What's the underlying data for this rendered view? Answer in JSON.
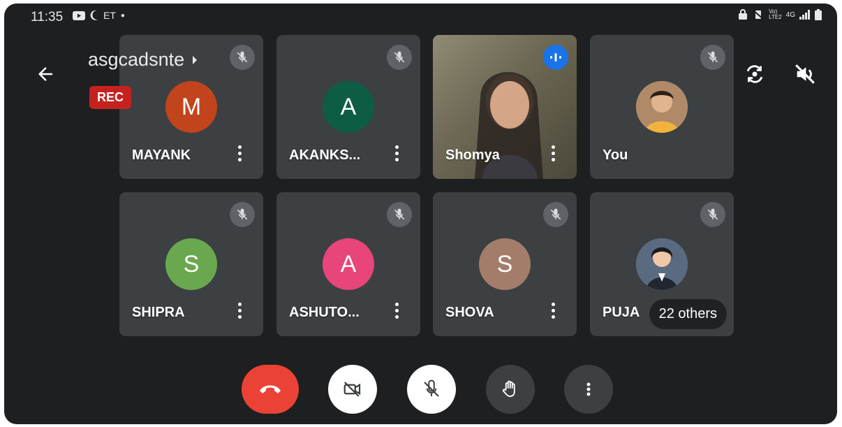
{
  "status_bar": {
    "time": "11:35",
    "carrier_text": "ET",
    "network_text": "4G"
  },
  "meeting": {
    "name": "asgcadsnte",
    "rec_label": "REC"
  },
  "participants": [
    {
      "name": "MAYANK",
      "initial": "M",
      "color": "#c1441c",
      "muted": true
    },
    {
      "name": "AKANKS...",
      "initial": "A",
      "color": "#0d5c46",
      "muted": true
    },
    {
      "name": "Shomya",
      "initial": "",
      "color": "#1a73e8",
      "muted": false,
      "speaking": true
    },
    {
      "name": "You",
      "initial": "",
      "color": "#c9a27a",
      "muted": true
    },
    {
      "name": "SHIPRA",
      "initial": "S",
      "color": "#6aa84f",
      "muted": true
    },
    {
      "name": "ASHUTO...",
      "initial": "A",
      "color": "#e8457a",
      "muted": true
    },
    {
      "name": "SHOVA",
      "initial": "S",
      "color": "#a47d6a",
      "muted": true
    },
    {
      "name": "PUJA",
      "initial": "",
      "color": "#7d8b9e",
      "muted": true
    }
  ],
  "others_label": "22 others",
  "controls": [
    "end-call",
    "camera-off",
    "mic-off",
    "raise-hand",
    "more-options"
  ]
}
